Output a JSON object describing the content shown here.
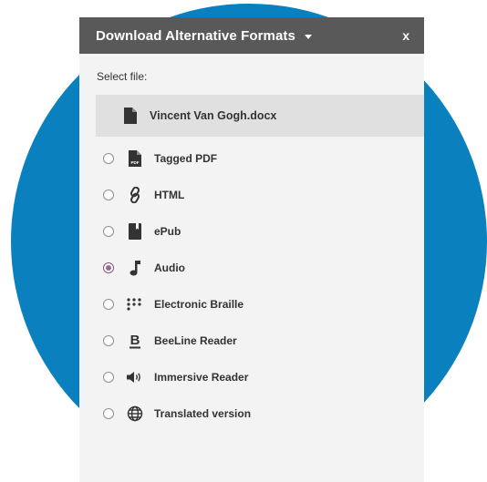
{
  "dialog": {
    "title": "Download Alternative Formats",
    "close_label": "x",
    "select_label": "Select file:",
    "file_name": "Vincent Van Gogh.docx"
  },
  "options": [
    {
      "label": "Tagged PDF",
      "icon": "pdf-file-icon",
      "checked": false
    },
    {
      "label": "HTML",
      "icon": "link-icon",
      "checked": false
    },
    {
      "label": "ePub",
      "icon": "book-icon",
      "checked": false
    },
    {
      "label": "Audio",
      "icon": "music-note-icon",
      "checked": true
    },
    {
      "label": "Electronic Braille",
      "icon": "braille-icon",
      "checked": false
    },
    {
      "label": "BeeLine Reader",
      "icon": "beeline-icon",
      "checked": false
    },
    {
      "label": "Immersive Reader",
      "icon": "speaker-icon",
      "checked": false
    },
    {
      "label": "Translated version",
      "icon": "globe-icon",
      "checked": false
    }
  ],
  "colors": {
    "background_circle": "#0a80be",
    "titlebar": "#595959",
    "panel": "#f3f3f3",
    "selected_file": "#e0e0e0",
    "radio_checked": "#9a6a93"
  }
}
